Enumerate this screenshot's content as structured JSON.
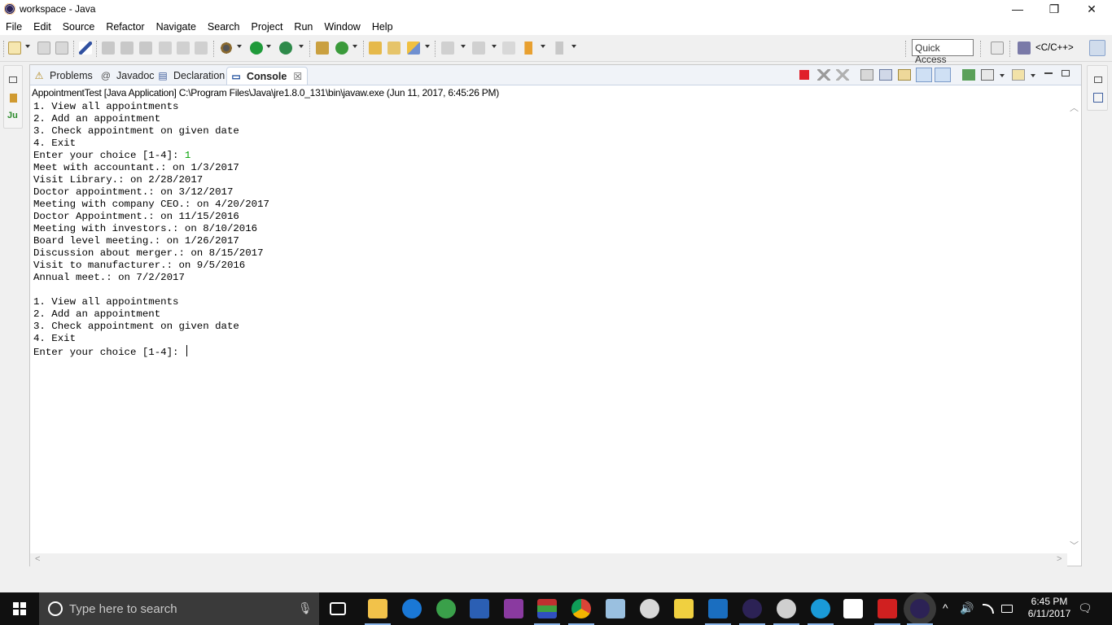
{
  "window": {
    "title": "workspace - Java",
    "minimize_glyph": "—",
    "maximize_glyph": "❐",
    "close_glyph": "✕"
  },
  "menu": [
    "File",
    "Edit",
    "Source",
    "Refactor",
    "Navigate",
    "Search",
    "Project",
    "Run",
    "Window",
    "Help"
  ],
  "toolbar": {
    "quick_access": "Quick Access",
    "perspective_label": "<C/C++>"
  },
  "left_trim": {
    "junit_label": "Ju"
  },
  "tabs": [
    {
      "label": "Problems",
      "icon": "problems-icon",
      "glyph": "⚠"
    },
    {
      "label": "Javadoc",
      "icon": "javadoc-icon",
      "glyph": "@"
    },
    {
      "label": "Declaration",
      "icon": "declaration-icon",
      "glyph": "▤"
    },
    {
      "label": "Console",
      "icon": "console-icon",
      "glyph": "▭",
      "active": true,
      "close": "☒"
    }
  ],
  "console": {
    "description": "AppointmentTest [Java Application] C:\\Program Files\\Java\\jre1.8.0_131\\bin\\javaw.exe (Jun 11, 2017, 6:45:26 PM)",
    "output_before_input": "1. View all appointments\n2. Add an appointment\n3. Check appointment on given date\n4. Exit\nEnter your choice [1-4]: ",
    "user_input": "1",
    "output_after_input": "\nMeet with accountant.: on 1/3/2017\nVisit Library.: on 2/28/2017\nDoctor appointment.: on 3/12/2017\nMeeting with company CEO.: on 4/20/2017\nDoctor Appointment.: on 11/15/2016\nMeeting with investors.: on 8/10/2016\nBoard level meeting.: on 1/26/2017\nDiscussion about merger.: on 8/15/2017\nVisit to manufacturer.: on 9/5/2016\nAnnual meet.: on 7/2/2017\n\n1. View all appointments\n2. Add an appointment\n3. Check appointment on given date\n4. Exit\nEnter your choice [1-4]: "
  },
  "scroll": {
    "up": "︿",
    "down": "﹀",
    "left": "<",
    "right": ">"
  },
  "taskbar": {
    "search_placeholder": "Type here to search",
    "mic_glyph": "🎙",
    "clock_time": "6:45 PM",
    "clock_date": "6/11/2017",
    "tray_chevron": "^",
    "volume_glyph": "🔊",
    "notification_glyph": "🗨"
  },
  "colors": {
    "console_input": "#00a000",
    "tab_bar": "#f0f3f8",
    "taskbar": "#101010",
    "stop_button": "#e0202a"
  }
}
